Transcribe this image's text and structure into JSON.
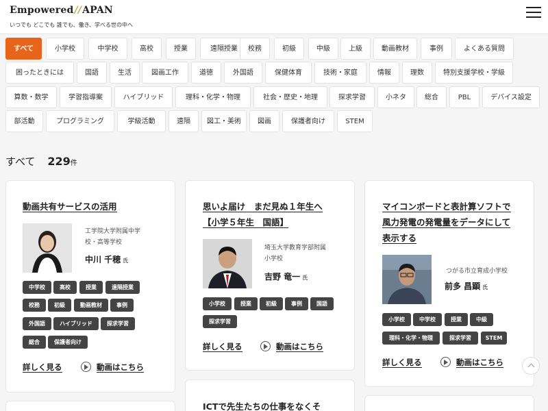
{
  "header": {
    "logo_left": "Empowered",
    "logo_slash": "//",
    "logo_right": "APAN",
    "tagline": "いつでも どこでも 誰でも、働き、学べる世の中へ"
  },
  "filters": [
    "すべて",
    "小学校",
    "中学校",
    "高校",
    "授業",
    "遠隔授業",
    "校務",
    "初級",
    "中級",
    "上級",
    "動画教材",
    "事例",
    "よくある質問",
    "困ったときには",
    "国語",
    "生活",
    "図画工作",
    "道徳",
    "外国語",
    "保健体育",
    "技術・家庭",
    "情報",
    "理数",
    "特別支援学校・学級",
    "算数・数学",
    "学習指導案",
    "ハイブリッド",
    "理科・化学・物理",
    "社会・歴史・地理",
    "探求学習",
    "小ネタ",
    "総合",
    "PBL",
    "デバイス設定",
    "部活動",
    "プログラミング",
    "学級活動",
    "遠隔",
    "図工・美術",
    "図画",
    "保護者向け",
    "STEM"
  ],
  "result": {
    "label": "すべて",
    "count": "229",
    "unit": "件"
  },
  "cards": [
    {
      "title": [
        "動画共有サービスの活用"
      ],
      "affiliation": [
        "工学院大学附属中学",
        "校・高等学校"
      ],
      "name": "中川 千穂",
      "honorific": "氏",
      "tags": [
        "中学校",
        "高校",
        "授業",
        "遠隔授業",
        "校務",
        "初級",
        "動画教材",
        "事例",
        "外国語",
        "ハイブリッド",
        "探求学習",
        "総合",
        "保護者向け"
      ],
      "details_label": "詳しく見る",
      "video_label": "動画はこちら"
    },
    {
      "title": [
        "思いよ届け　まだ見ぬ１年生へ",
        "【小学５年生　国語】"
      ],
      "affiliation": [
        "埼玉大学教育学部附属",
        "小学校"
      ],
      "name": "吉野 竜一",
      "honorific": "氏",
      "tags": [
        "小学校",
        "授業",
        "初級",
        "事例",
        "国語",
        "探求学習"
      ],
      "details_label": "詳しく見る",
      "video_label": "動画はこちら"
    },
    {
      "title": [
        "マイコンボードと表計算ソフトで",
        "風力発電の発電量をデータにして",
        "表示する"
      ],
      "affiliation": [
        "つがる市立育成小学校"
      ],
      "name": "前多 昌顕",
      "honorific": "氏",
      "tags": [
        "小学校",
        "中学校",
        "授業",
        "中級",
        "理科・化学・物理",
        "探求学習",
        "STEM"
      ],
      "details_label": "詳しく見る",
      "video_label": "動画はこちら"
    },
    {
      "title": [
        "ICTで先生たちの仕事をなくそ"
      ]
    }
  ]
}
